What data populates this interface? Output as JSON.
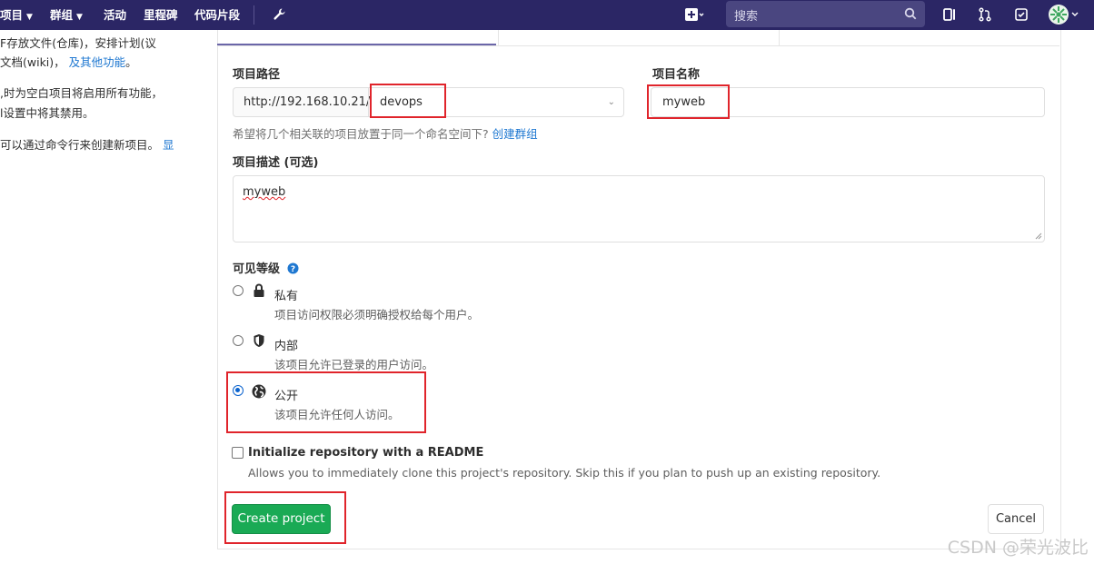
{
  "navbar": {
    "items": [
      {
        "label": "项目",
        "has_caret": true
      },
      {
        "label": "群组",
        "has_caret": true
      },
      {
        "label": "活动",
        "has_caret": false
      },
      {
        "label": "里程碑",
        "has_caret": false
      },
      {
        "label": "代码片段",
        "has_caret": false
      }
    ],
    "search_placeholder": "搜索",
    "icons": [
      "wrench-icon",
      "plus-square-icon",
      "search-icon",
      "sidebar-toggle-icon",
      "merge-request-icon",
      "todo-check-icon",
      "avatar"
    ]
  },
  "left_text": {
    "line1": "F存放文件(仓库)，安排计划(议",
    "line2_text": "文档(wiki)，",
    "line2_link": "及其他功能",
    "line2_tail": "。",
    "line3": ",时为空白项目将启用所有功能，",
    "line4": "l设置中将其禁用。",
    "line5_text": "可以通过命令行来创建新项目。",
    "line5_link": "显"
  },
  "form": {
    "path_label": "项目路径",
    "path_prefix": "http://192.168.10.21/",
    "namespace_value": "devops",
    "name_label": "项目名称",
    "name_value": "myweb",
    "group_help_text": "希望将几个相关联的项目放置于同一个命名空间下?",
    "group_help_link": "创建群组",
    "description_label": "项目描述 (可选)",
    "description_value": "myweb",
    "visibility_label": "可见等级",
    "visibility_options": [
      {
        "title": "私有",
        "description": "项目访问权限必须明确授权给每个用户。",
        "icon": "lock-icon",
        "selected": false
      },
      {
        "title": "内部",
        "description": "该项目允许已登录的用户访问。",
        "icon": "shield-icon",
        "selected": false
      },
      {
        "title": "公开",
        "description": "该项目允许任何人访问。",
        "icon": "globe-icon",
        "selected": true
      }
    ],
    "readme_label": "Initialize repository with a README",
    "readme_help": "Allows you to immediately clone this project's repository. Skip this if you plan to push up an existing repository.",
    "readme_checked": false,
    "create_button": "Create project",
    "cancel_button": "Cancel"
  },
  "colors": {
    "navbar": "#2b2665",
    "highlight": "#e0242b",
    "primary_button": "#1aaa55",
    "link": "#1f78d1"
  },
  "watermark": "CSDN @荣光波比"
}
